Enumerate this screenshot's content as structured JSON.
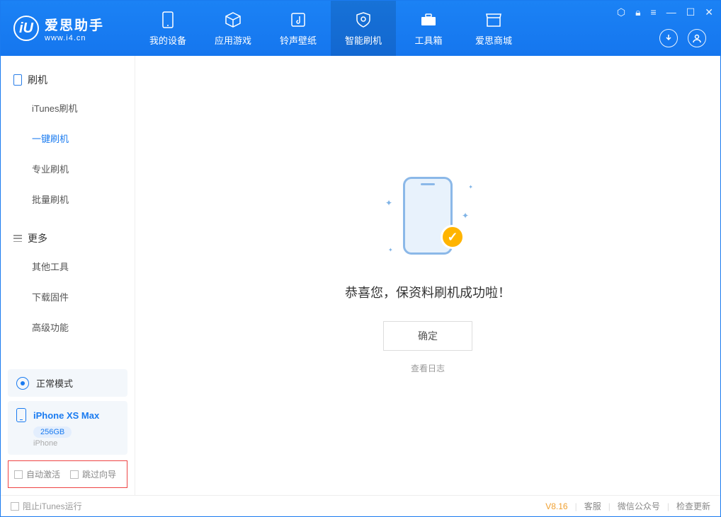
{
  "app": {
    "name": "爱思助手",
    "url": "www.i4.cn"
  },
  "nav": {
    "items": [
      {
        "label": "我的设备"
      },
      {
        "label": "应用游戏"
      },
      {
        "label": "铃声壁纸"
      },
      {
        "label": "智能刷机"
      },
      {
        "label": "工具箱"
      },
      {
        "label": "爱思商城"
      }
    ],
    "active_index": 3
  },
  "sidebar": {
    "section1_title": "刷机",
    "section1_items": [
      {
        "label": "iTunes刷机"
      },
      {
        "label": "一键刷机"
      },
      {
        "label": "专业刷机"
      },
      {
        "label": "批量刷机"
      }
    ],
    "section1_active": 1,
    "section2_title": "更多",
    "section2_items": [
      {
        "label": "其他工具"
      },
      {
        "label": "下载固件"
      },
      {
        "label": "高级功能"
      }
    ],
    "mode_label": "正常模式",
    "device": {
      "name": "iPhone XS Max",
      "capacity": "256GB",
      "type": "iPhone"
    },
    "checkbox_auto_activate": "自动激活",
    "checkbox_skip_guide": "跳过向导"
  },
  "main": {
    "success_text": "恭喜您，保资料刷机成功啦！",
    "ok_button": "确定",
    "view_log": "查看日志"
  },
  "footer": {
    "block_itunes": "阻止iTunes运行",
    "version": "V8.16",
    "links": [
      "客服",
      "微信公众号",
      "检查更新"
    ]
  }
}
